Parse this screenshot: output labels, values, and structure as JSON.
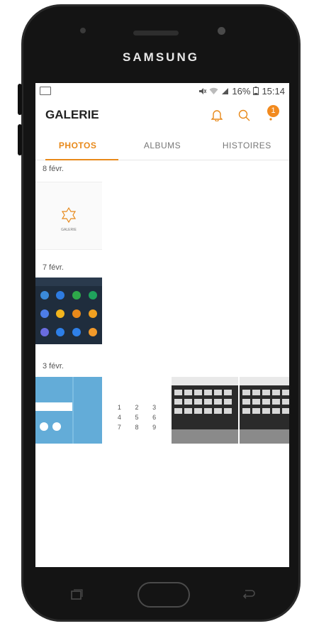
{
  "device": {
    "brand": "SAMSUNG"
  },
  "status_bar": {
    "battery": "16%",
    "time": "15:14",
    "icons": [
      "image-notification-icon",
      "mute-icon",
      "wifi-icon",
      "signal-icon",
      "battery-icon"
    ]
  },
  "app_bar": {
    "title": "GALERIE",
    "badge_count": "1",
    "icons": [
      "bell-icon",
      "search-icon",
      "more-icon"
    ]
  },
  "tabs": [
    {
      "label": "PHOTOS",
      "active": true
    },
    {
      "label": "ALBUMS",
      "active": false
    },
    {
      "label": "HISTOIRES",
      "active": false
    }
  ],
  "groups": [
    {
      "date": "8 févr.",
      "thumbs": [
        {
          "kind": "gallery-app-icon",
          "label": "GALERIE"
        }
      ]
    },
    {
      "date": "7 févr.",
      "thumbs": [
        {
          "kind": "apps-screen"
        }
      ]
    },
    {
      "date": "3 févr.",
      "thumbs": [
        {
          "kind": "settings-screen"
        },
        {
          "kind": "dialer-screen"
        },
        {
          "kind": "keyboard-photo"
        },
        {
          "kind": "keyboard-photo"
        }
      ]
    }
  ],
  "dialer_keys": [
    "1",
    "2",
    "3",
    "4",
    "5",
    "6",
    "7",
    "8",
    "9"
  ],
  "colors": {
    "accent": "#e8891a",
    "badge": "#f28a1e",
    "phone_body": "#141414"
  }
}
